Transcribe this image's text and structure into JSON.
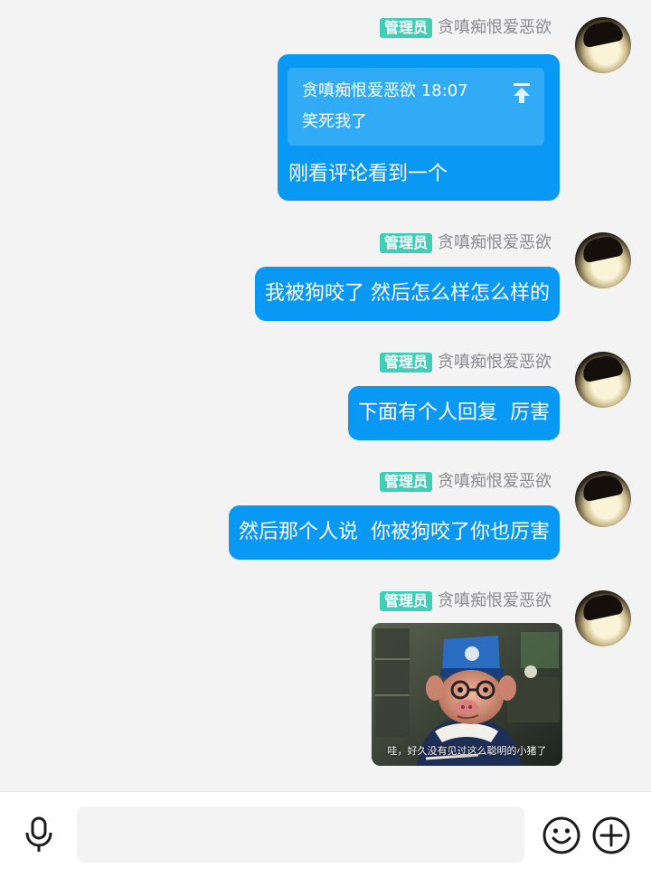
{
  "messages": [
    {
      "badge": "管理员",
      "sender": "贪嗔痴恨爱恶欲",
      "quote": {
        "header": "贪嗔痴恨爱恶欲 18:07",
        "text": "笑死我了"
      },
      "text": "刚看评论看到一个"
    },
    {
      "badge": "管理员",
      "sender": "贪嗔痴恨爱恶欲",
      "text": "我被狗咬了 然后怎么样怎么样的"
    },
    {
      "badge": "管理员",
      "sender": "贪嗔痴恨爱恶欲",
      "text": "下面有个人回复  厉害"
    },
    {
      "badge": "管理员",
      "sender": "贪嗔痴恨爱恶欲",
      "text": "然后那个人说  你被狗咬了你也厉害"
    },
    {
      "badge": "管理员",
      "sender": "贪嗔痴恨爱恶欲",
      "image_caption": "哇，好久没有见过这么聪明的小猪了"
    }
  ],
  "input_bar": {
    "icons": [
      "microphone-icon",
      "emoji-icon",
      "plus-icon"
    ],
    "placeholder": ""
  },
  "colors": {
    "bubble": "#0a98f5",
    "badge": "#3ecfb6",
    "background": "#f3f3f4"
  }
}
